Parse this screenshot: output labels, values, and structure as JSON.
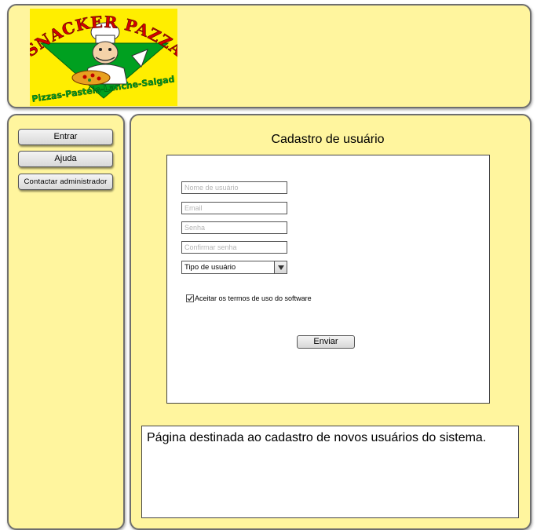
{
  "logo": {
    "name": "SNACKER PAZZA",
    "tagline": "Pizzas-Pastéis-Lanche-Salgad"
  },
  "sidebar": {
    "items": [
      {
        "label": "Entrar"
      },
      {
        "label": "Ajuda"
      },
      {
        "label": "Contactar administrador"
      }
    ]
  },
  "form": {
    "title": "Cadastro de usuário",
    "fields": {
      "username": {
        "value": "",
        "placeholder": "Nome de usuário"
      },
      "email": {
        "value": "",
        "placeholder": "Email"
      },
      "password": {
        "value": "",
        "placeholder": "Senha"
      },
      "confirm": {
        "value": "",
        "placeholder": "Confirmar senha"
      }
    },
    "user_type": {
      "selected": "Tipo de usuário"
    },
    "terms": {
      "label": "Aceitar os termos de uso do software",
      "checked": true
    },
    "submit_label": "Enviar"
  },
  "description": "Página destinada ao cadastro de novos usuários do sistema.",
  "colors": {
    "panel_background": "#fff59e",
    "logo_background": "#ffee00",
    "logo_text": "#d40000",
    "logo_accent": "#00a020"
  }
}
